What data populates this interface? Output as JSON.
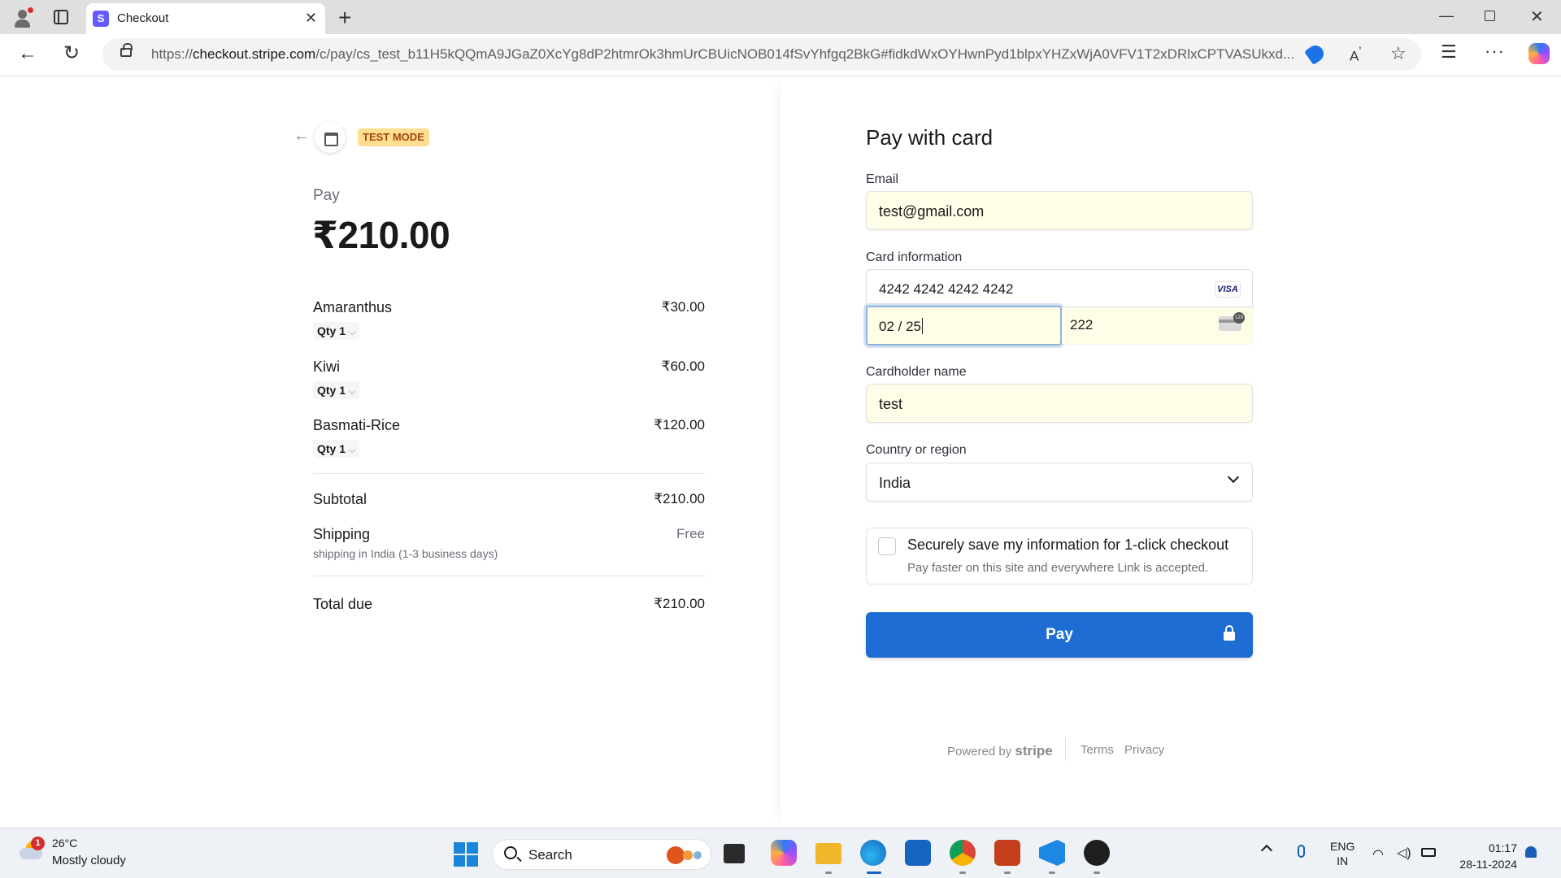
{
  "browser": {
    "tab_title": "Checkout",
    "tab_favicon_letter": "S",
    "url_prefix": "https://",
    "url_domain": "checkout.stripe.com",
    "url_path": "/c/pay/cs_test_b11H5kQQmA9JGaZ0XcYg8dP2htmrOk3hmUrCBUicNOB014fSvYhfgq2BkG#fidkdWxOYHwnPyd1blpxYHZxWjA0VFV1T2xDRlxCPTVASUkxd..."
  },
  "summary": {
    "test_badge": "TEST MODE",
    "pay_label": "Pay",
    "amount": "₹210.00",
    "items": [
      {
        "name": "Amaranthus",
        "qty": "Qty 1",
        "price": "₹30.00"
      },
      {
        "name": "Kiwi",
        "qty": "Qty 1",
        "price": "₹60.00"
      },
      {
        "name": "Basmati-Rice",
        "qty": "Qty 1",
        "price": "₹120.00"
      }
    ],
    "subtotal_label": "Subtotal",
    "subtotal_value": "₹210.00",
    "shipping_label": "Shipping",
    "shipping_desc": "shipping in India (1-3 business days)",
    "shipping_value": "Free",
    "total_label": "Total due",
    "total_value": "₹210.00"
  },
  "form": {
    "title": "Pay with card",
    "email_label": "Email",
    "email_value": "test@gmail.com",
    "card_label": "Card information",
    "card_number": "4242 4242 4242 4242",
    "card_brand": "VISA",
    "expiry": "02 / 25",
    "cvc": "222",
    "name_label": "Cardholder name",
    "name_value": "test",
    "country_label": "Country or region",
    "country_value": "India",
    "save_title": "Securely save my information for 1-click checkout",
    "save_sub": "Pay faster on this site and everywhere Link is accepted.",
    "pay_button": "Pay",
    "accent_color": "#1e6dd4"
  },
  "footer": {
    "powered_by": "Powered by",
    "stripe": "stripe",
    "terms": "Terms",
    "privacy": "Privacy"
  },
  "taskbar": {
    "weather_badge": "1",
    "temp": "26°C",
    "weather": "Mostly cloudy",
    "search": "Search",
    "lang_line1": "ENG",
    "lang_line2": "IN",
    "time": "01:17",
    "date": "28-11-2024"
  }
}
